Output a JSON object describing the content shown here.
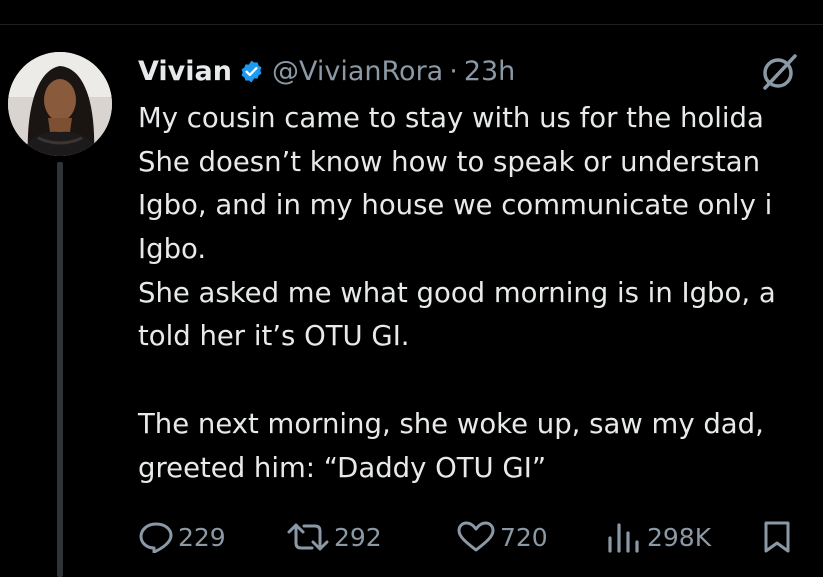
{
  "tweet": {
    "author_name": "Vivian",
    "handle": "@VivianRora",
    "separator": "·",
    "time": "23h",
    "lines": [
      "My cousin came to stay with us for the holida",
      "She doesn’t know how to speak or understan",
      "Igbo, and in my house we communicate only i",
      "Igbo.",
      "She asked me what good morning is in Igbo, a",
      "told her it’s OTU GI.",
      "",
      "The next morning, she woke up, saw my dad,",
      "greeted him: “Daddy OTU GI”"
    ]
  },
  "actions": {
    "replies": "229",
    "reposts": "292",
    "likes": "720",
    "views": "298K"
  },
  "colors": {
    "background": "#000000",
    "text": "#e7e9ea",
    "muted": "#8b98a5",
    "verified": "#1d9bf0"
  },
  "icons": [
    "verified-badge-icon",
    "grok-icon",
    "reply-icon",
    "repost-icon",
    "like-icon",
    "views-icon",
    "bookmark-icon"
  ]
}
